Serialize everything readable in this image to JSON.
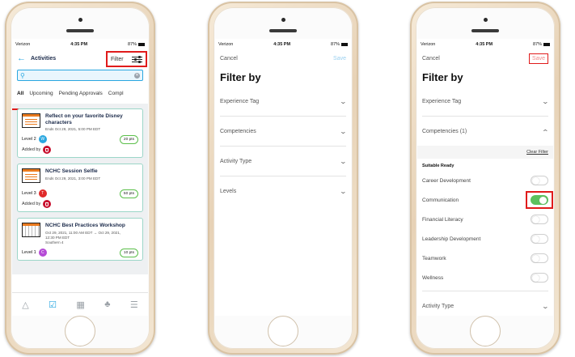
{
  "phone1": {
    "status": {
      "carrier": "Verizon",
      "time": "4:35 PM",
      "battery": "87%"
    },
    "header": {
      "back_icon": "arrow-left-icon",
      "title": "Activities",
      "filter_label": "Filter"
    },
    "search": {
      "placeholder": ""
    },
    "tabs": [
      "All",
      "Upcoming",
      "Pending Approvals",
      "Compl"
    ],
    "cards": [
      {
        "title": "Reflect on your favorite Disney characters",
        "meta": [
          "Ends Oct 29, 2021, 5:00 PM EDT"
        ],
        "level": "Level 2",
        "badge": "W",
        "badge_color": "#2aa7e0",
        "points": "20 pts",
        "added_by": "Added by"
      },
      {
        "title": "NCHC Session Selfie",
        "meta": [
          "Ends Oct 29, 2021, 3:00 PM EDT"
        ],
        "level": "Level 3",
        "badge": "T",
        "badge_color": "#e02a2a",
        "points": "50 pts",
        "added_by": "Added by"
      },
      {
        "title": "NCHC Best Practices Workshop",
        "meta": [
          "Oct 29, 2021, 11:00 AM EDT → Oct 29, 2021,",
          "12:30 PM EDT",
          "Southern 4"
        ],
        "level": "Level 1",
        "badge": "C",
        "badge_color": "#b54bd6",
        "points": "10 pts",
        "added_by": ""
      }
    ],
    "tabbar": [
      "home-icon",
      "activities-icon",
      "qr-code-icon",
      "notifications-icon",
      "menu-icon"
    ]
  },
  "phone2": {
    "status": {
      "carrier": "Verizon",
      "time": "4:35 PM",
      "battery": "87%"
    },
    "cancel": "Cancel",
    "save": "Save",
    "title": "Filter by",
    "rows": [
      "Experience Tag",
      "Competencies",
      "Activity Type",
      "Levels"
    ]
  },
  "phone3": {
    "status": {
      "carrier": "Verizon",
      "time": "4:35 PM",
      "battery": "87%"
    },
    "cancel": "Cancel",
    "save": "Save",
    "title": "Filter by",
    "experience_tag": "Experience Tag",
    "competencies": "Competencies (1)",
    "clear_filter": "Clear Filter",
    "group": "Suitable Ready",
    "toggles": [
      {
        "label": "Career Development",
        "on": false
      },
      {
        "label": "Communication",
        "on": true
      },
      {
        "label": "Financial Literacy",
        "on": false
      },
      {
        "label": "Leadership Development",
        "on": false
      },
      {
        "label": "Teamwork",
        "on": false
      },
      {
        "label": "Wellness",
        "on": false
      }
    ],
    "activity_type": "Activity Type"
  },
  "colors": {
    "accent": "#2aa7e0",
    "highlight": "#e01b1b",
    "toggle_on": "#5cc15e",
    "save_disabled": "#9ad0f0"
  }
}
